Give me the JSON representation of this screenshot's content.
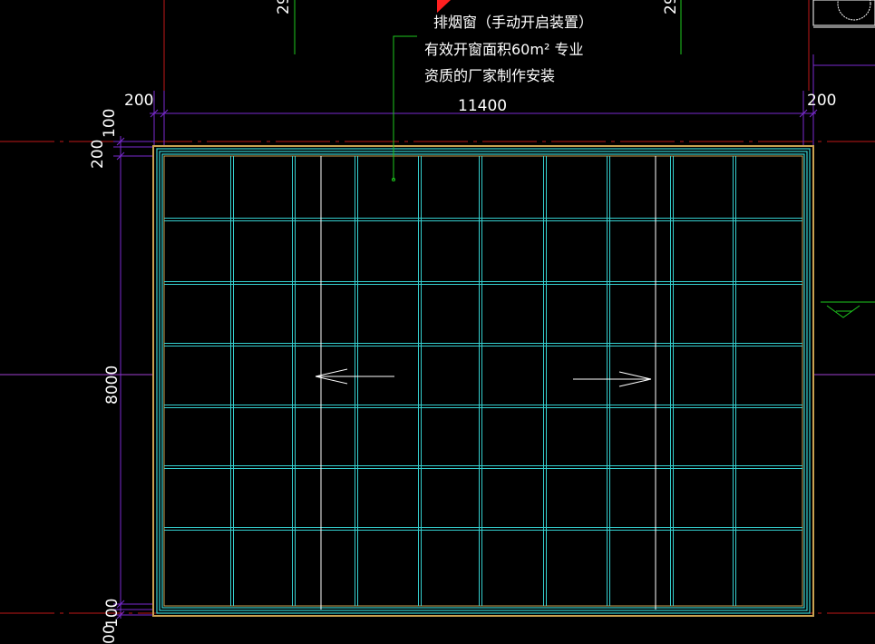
{
  "annotation": {
    "line1": "排烟窗（手动开启装置）",
    "line2": "有效开窗面积60m²  专业",
    "line3": "资质的厂家制作安装"
  },
  "dimensions": {
    "left_offset": "200",
    "right_offset": "200",
    "overall_width": "11400",
    "top_a": "100",
    "top_b": "200",
    "overall_height": "8000",
    "bottom_a": "100",
    "bottom_b": "00"
  },
  "partial_labels": {
    "top_left": "29",
    "top_right": "29"
  },
  "colors": {
    "background": "#000000",
    "grid": "#35d0d0",
    "frame_outer": "#c8a050",
    "dimension": "#7a2ad0",
    "axis": "#c01818",
    "leader": "#1ec81e",
    "text": "#ffffff",
    "flag": "#ff2020"
  }
}
